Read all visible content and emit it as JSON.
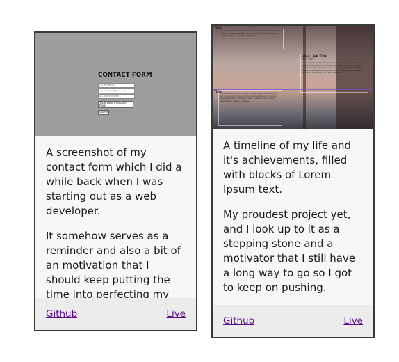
{
  "cards": [
    {
      "thumbnail": {
        "form_title": "CONTACT FORM",
        "fields": [
          "e.g. Full Name",
          "e.g. example@gmail.com",
          "e.g. 050 000 0000"
        ],
        "textarea": "Type your message here",
        "submit": "Submit"
      },
      "paragraphs": [
        "A screenshot of my contact form which I did a while back when I was starting out as a web developer.",
        "It somehow serves as a reminder and also a bit of an motivation that I should keep putting the time into perfecting my craft."
      ],
      "links": {
        "github": "Github",
        "live": "Live"
      }
    },
    {
      "thumbnail": {
        "heading_left": "Title",
        "job_title": "Job 3 - Job Title",
        "job_years": "2017-2018",
        "heading_lower": "Title"
      },
      "paragraphs": [
        "A timeline of my life and it's achievements, filled with blocks of Lorem Ipsum text.",
        "My proudest project yet, and I look up to it as a stepping stone and a motivator that I still have a long way to go so I got to keep on pushing."
      ],
      "links": {
        "github": "Github",
        "live": "Live"
      }
    }
  ],
  "colors": {
    "link": "#5a0b8c",
    "border": "#3a3a3a",
    "card_bg": "#f7f7f7",
    "footer_bg": "#ececec"
  }
}
